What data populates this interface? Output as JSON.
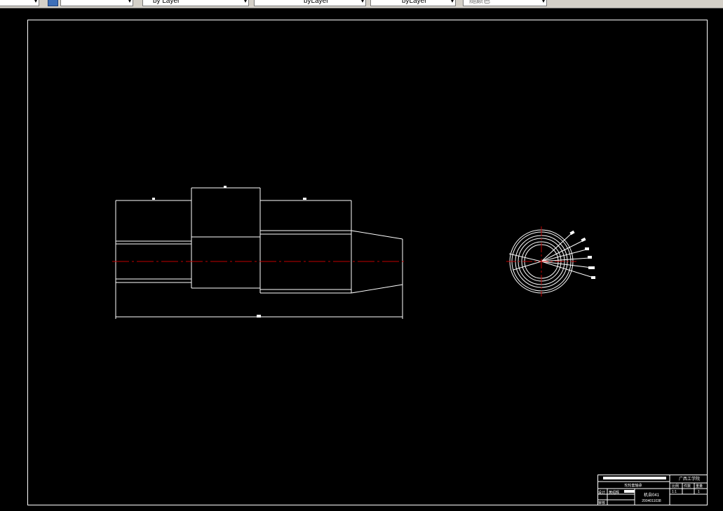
{
  "toolbar": {
    "layer_combo": "by Layer",
    "linetype_combo": "byLayer",
    "lineweight_combo": "byLayer",
    "color_combo": "随颜色"
  },
  "title_block": {
    "school": "广西工学院",
    "part_name": "轮轮套轴承",
    "cells": [
      "比例",
      "件数",
      "重量"
    ],
    "values": [
      "1:1",
      "1"
    ],
    "designer_label": "设计",
    "designer_name": "黄绍辉",
    "check_label": "审核",
    "class_label": "机自041",
    "student_id": "2004011038"
  },
  "colors": {
    "background": "#000000",
    "line": "#ffffff",
    "centerline": "#c00000"
  }
}
